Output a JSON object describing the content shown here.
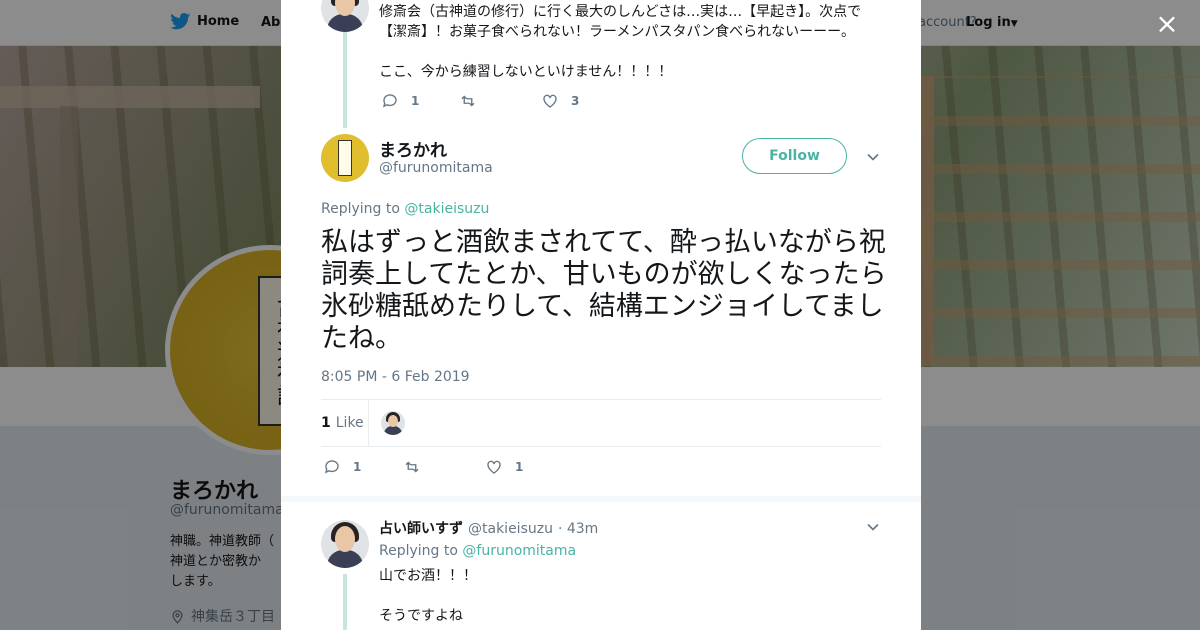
{
  "nav": {
    "home_label": "Home",
    "about_label": "Abo",
    "account_text": "account?",
    "login_label": "Log in"
  },
  "profile": {
    "name": "まろかれ",
    "handle": "@furunomitama",
    "bio": "神職。神道教師（\n神道とか密教か\nします。",
    "location": "神集岳３丁目",
    "avatar_book_text": "古神道祝詞"
  },
  "close_label": "×",
  "prev_tweet": {
    "text": "修斎会（古神道の修行）に行く最大のしんどさは…実は…【早起き】。次点で\n【潔斎】！お菓子食べられない！ラーメンパスタパン食べられないーーー。\n\nここ、今から練習しないといけません！！！！",
    "reply_count": "1",
    "like_count": "3"
  },
  "main_tweet": {
    "author_name": "まろかれ",
    "author_handle": "@furunomitama",
    "follow_label": "Follow",
    "replying_prefix": "Replying to",
    "replying_mention": "@takieisuzu",
    "text": "私はずっと酒飲まされてて、酔っ払いながら祝詞奏上してたとか、甘いものが欲しくなったら氷砂糖舐めたりして、結構エンジョイしてましたね。",
    "timestamp": "8:05 PM - 6 Feb 2019",
    "likes_count": "1",
    "likes_label": "Like",
    "reply_count": "1",
    "like_count": "1"
  },
  "reply_tweet": {
    "author_name": "占い師いすず",
    "author_handle": "@takieisuzu",
    "time": "· 43m",
    "replying_prefix": "Replying to",
    "replying_mention": "@furunomitama",
    "text": "山でお酒！！！\n\nそうですよね"
  },
  "colors": {
    "accent": "#4ab3a4",
    "twitter_blue": "#1da1f2",
    "muted": "#657786"
  }
}
